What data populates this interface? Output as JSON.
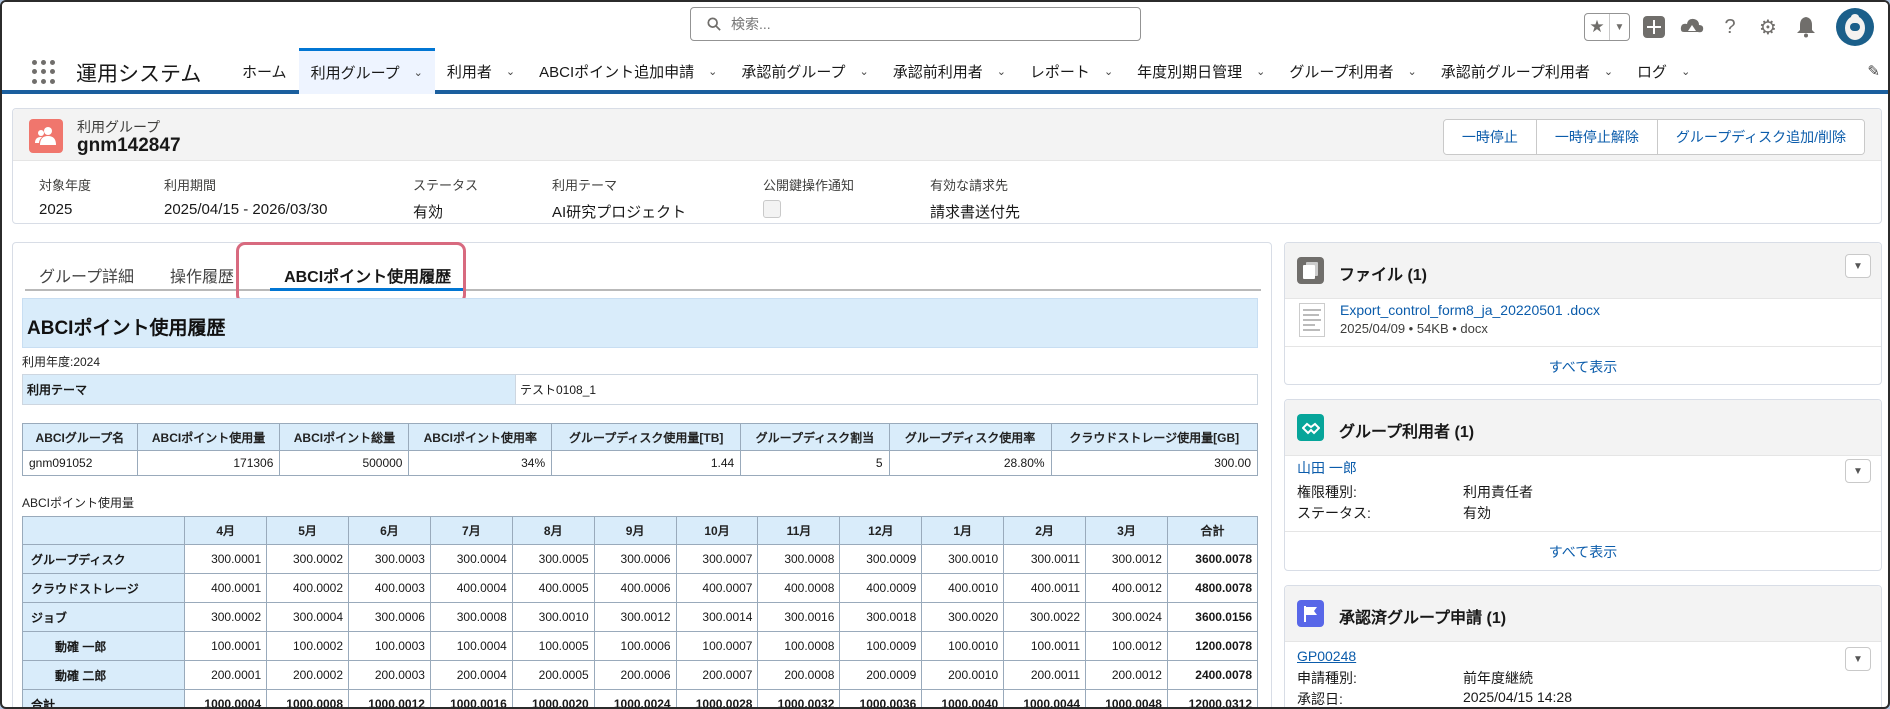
{
  "header": {
    "search_placeholder": "検索...",
    "star_icon": "★",
    "avatar_icon": "astro-avatar"
  },
  "nav": {
    "app_name": "運用システム",
    "tabs": [
      {
        "label": "ホーム",
        "has_menu": false
      },
      {
        "label": "利用グループ",
        "has_menu": true,
        "active": true
      },
      {
        "label": "利用者",
        "has_menu": true
      },
      {
        "label": "ABCIポイント追加申請",
        "has_menu": true
      },
      {
        "label": "承認前グループ",
        "has_menu": true
      },
      {
        "label": "承認前利用者",
        "has_menu": true
      },
      {
        "label": "レポート",
        "has_menu": true
      },
      {
        "label": "年度別期日管理",
        "has_menu": true
      },
      {
        "label": "グループ利用者",
        "has_menu": true
      },
      {
        "label": "承認前グループ利用者",
        "has_menu": true
      },
      {
        "label": "ログ",
        "has_menu": true
      }
    ]
  },
  "record": {
    "object_type": "利用グループ",
    "name": "gnm142847",
    "actions": [
      "一時停止",
      "一時停止解除",
      "グループディスク追加/削除"
    ],
    "fields": [
      {
        "label": "対象年度",
        "value": "2025"
      },
      {
        "label": "利用期間",
        "value": "2025/04/15 - 2026/03/30"
      },
      {
        "label": "ステータス",
        "value": "有効"
      },
      {
        "label": "利用テーマ",
        "value": "AI研究プロジェクト"
      },
      {
        "label": "公開鍵操作通知",
        "value": ""
      },
      {
        "label": "有効な請求先",
        "value": "請求書送付先"
      }
    ]
  },
  "tabs": {
    "items": [
      "グループ詳細",
      "操作履歴",
      "ABCIポイント使用履歴"
    ],
    "active": "ABCIポイント使用履歴"
  },
  "report": {
    "title": "ABCIポイント使用履歴",
    "year_label": "利用年度:2024",
    "theme_label": "利用テーマ",
    "theme_value": "テスト0108_1",
    "summary_headers": [
      "ABCIグループ名",
      "ABCIポイント使用量",
      "ABCIポイント総量",
      "ABCIポイント使用率",
      "グループディスク使用量[TB]",
      "グループディスク割当",
      "グループディスク使用率",
      "クラウドストレージ使用量[GB]"
    ],
    "summary_row": [
      "gnm091052",
      "171306",
      "500000",
      "34%",
      "1.44",
      "5",
      "28.80%",
      "300.00"
    ],
    "usage_caption": "ABCIポイント使用量",
    "months": [
      "4月",
      "5月",
      "6月",
      "7月",
      "8月",
      "9月",
      "10月",
      "11月",
      "12月",
      "1月",
      "2月",
      "3月",
      "合計"
    ],
    "usage_rows": [
      {
        "label": "グループディスク",
        "values": [
          "300.0001",
          "300.0002",
          "300.0003",
          "300.0004",
          "300.0005",
          "300.0006",
          "300.0007",
          "300.0008",
          "300.0009",
          "300.0010",
          "300.0011",
          "300.0012",
          "3600.0078"
        ]
      },
      {
        "label": "クラウドストレージ",
        "values": [
          "400.0001",
          "400.0002",
          "400.0003",
          "400.0004",
          "400.0005",
          "400.0006",
          "400.0007",
          "400.0008",
          "400.0009",
          "400.0010",
          "400.0011",
          "400.0012",
          "4800.0078"
        ]
      },
      {
        "label": "ジョブ",
        "values": [
          "300.0002",
          "300.0004",
          "300.0006",
          "300.0008",
          "300.0010",
          "300.0012",
          "300.0014",
          "300.0016",
          "300.0018",
          "300.0020",
          "300.0022",
          "300.0024",
          "3600.0156"
        ]
      },
      {
        "label": "動確 一郎",
        "sub": true,
        "values": [
          "100.0001",
          "100.0002",
          "100.0003",
          "100.0004",
          "100.0005",
          "100.0006",
          "100.0007",
          "100.0008",
          "100.0009",
          "100.0010",
          "100.0011",
          "100.0012",
          "1200.0078"
        ]
      },
      {
        "label": "動確 二郎",
        "sub": true,
        "values": [
          "200.0001",
          "200.0002",
          "200.0003",
          "200.0004",
          "200.0005",
          "200.0006",
          "200.0007",
          "200.0008",
          "200.0009",
          "200.0010",
          "200.0011",
          "200.0012",
          "2400.0078"
        ]
      },
      {
        "label": "合計",
        "total": true,
        "values": [
          "1000.0004",
          "1000.0008",
          "1000.0012",
          "1000.0016",
          "1000.0020",
          "1000.0024",
          "1000.0028",
          "1000.0032",
          "1000.0036",
          "1000.0040",
          "1000.0044",
          "1000.0048",
          "12000.0312"
        ]
      }
    ]
  },
  "files_card": {
    "title": "ファイル (1)",
    "file_name": "Export_control_form8_ja_20220501 .docx",
    "file_meta": "2025/04/09 • 54KB • docx",
    "view_all": "すべて表示"
  },
  "group_users_card": {
    "title": "グループ利用者 (1)",
    "user_name": "山田 一郎",
    "fields": [
      {
        "label": "権限種別:",
        "value": "利用責任者"
      },
      {
        "label": "ステータス:",
        "value": "有効"
      }
    ],
    "view_all": "すべて表示"
  },
  "approved_card": {
    "title": "承認済グループ申請 (1)",
    "request_id": "GP00248",
    "fields": [
      {
        "label": "申請種別:",
        "value": "前年度継続"
      },
      {
        "label": "承認日:",
        "value": "2025/04/15 14:28"
      }
    ]
  },
  "colors": {
    "brand": "#0176d3",
    "nav_border": "#1b5f9e",
    "report_header": "#d9ecfa",
    "tab_highlight": "#d86a7f",
    "files_icon": "#706e6b",
    "users_icon": "#06a59a",
    "approved_icon": "#5867e8",
    "record_icon": "#f0766d"
  }
}
